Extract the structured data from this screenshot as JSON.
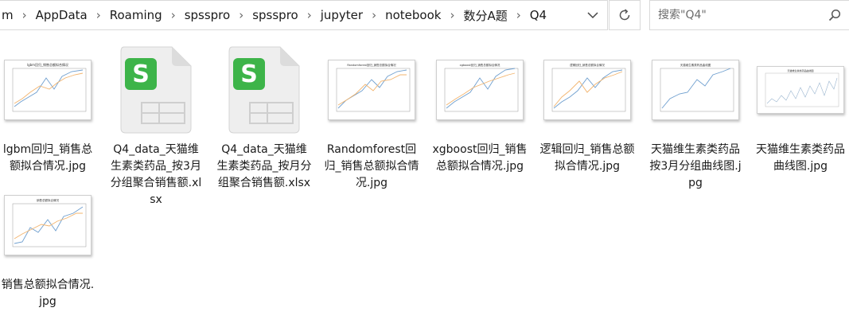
{
  "address_bar": {
    "crumbs": [
      "m",
      "AppData",
      "Roaming",
      "spsspro",
      "spsspro",
      "jupyter",
      "notebook",
      "数分A题",
      "Q4"
    ]
  },
  "search": {
    "placeholder": "搜索\"Q4\""
  },
  "files": [
    {
      "name": "lgbm回归_销售总额拟合情况.jpg",
      "thumb_title": "lgbm回归_销售总额拟合情况"
    },
    {
      "name": "Q4_data_天猫维生素类药品_按3月分组聚合销售额.xlsx"
    },
    {
      "name": "Q4_data_天猫维生素类药品_按月分组聚合销售额.xlsx"
    },
    {
      "name": "Randomforest回归_销售总额拟合情况.jpg",
      "thumb_title": "Randomforest回归_销售总额拟合情况"
    },
    {
      "name": "xgboost回归_销售总额拟合情况.jpg",
      "thumb_title": "xgboost回归_销售总额拟合情况"
    },
    {
      "name": "逻辑回归_销售总额拟合情况.jpg",
      "thumb_title": "逻辑回归_销售总额拟合情况"
    },
    {
      "name": "天猫维生素类药品按3月分组曲线图.jpg",
      "thumb_title": "天猫维生素类药品曲线图"
    },
    {
      "name": "天猫维生素类药品曲线图.jpg",
      "thumb_title": "天猫维生素类药品曲线图"
    },
    {
      "name": "销售总额拟合情况.jpg",
      "thumb_title": "销售总额拟合情况"
    }
  ],
  "colors": {
    "excel_green": "#3db449",
    "fit_blue": "#6f9fcf",
    "fit_orange": "#f2b46e"
  }
}
